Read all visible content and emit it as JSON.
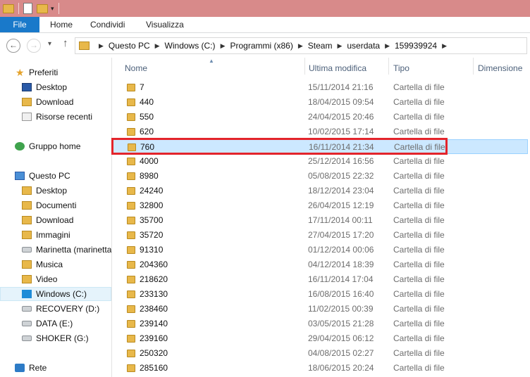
{
  "ribbon": {
    "tabs": [
      "File",
      "Home",
      "Condividi",
      "Visualizza"
    ]
  },
  "address": {
    "crumbs": [
      "Questo PC",
      "Windows (C:)",
      "Programmi (x86)",
      "Steam",
      "userdata",
      "159939924"
    ]
  },
  "nav": {
    "favorites_label": "Preferiti",
    "favorites": [
      "Desktop",
      "Download",
      "Risorse recenti"
    ],
    "homegroup_label": "Gruppo home",
    "thispc_label": "Questo PC",
    "thispc_items": [
      "Desktop",
      "Documenti",
      "Download",
      "Immagini",
      "Marinetta (marinetta",
      "Musica",
      "Video",
      "Windows (C:)",
      "RECOVERY (D:)",
      "DATA (E:)",
      "SHOKER (G:)"
    ],
    "network_label": "Rete",
    "selected": "Windows (C:)"
  },
  "columns": {
    "name": "Nome",
    "modified": "Ultima modifica",
    "type": "Tipo",
    "size": "Dimensione"
  },
  "files": [
    {
      "name": "7",
      "modified": "15/11/2014 21:16",
      "type": "Cartella di file"
    },
    {
      "name": "440",
      "modified": "18/04/2015 09:54",
      "type": "Cartella di file"
    },
    {
      "name": "550",
      "modified": "24/04/2015 20:46",
      "type": "Cartella di file"
    },
    {
      "name": "620",
      "modified": "10/02/2015 17:14",
      "type": "Cartella di file"
    },
    {
      "name": "760",
      "modified": "16/11/2014 21:34",
      "type": "Cartella di file"
    },
    {
      "name": "4000",
      "modified": "25/12/2014 16:56",
      "type": "Cartella di file"
    },
    {
      "name": "8980",
      "modified": "05/08/2015 22:32",
      "type": "Cartella di file"
    },
    {
      "name": "24240",
      "modified": "18/12/2014 23:04",
      "type": "Cartella di file"
    },
    {
      "name": "32800",
      "modified": "26/04/2015 12:19",
      "type": "Cartella di file"
    },
    {
      "name": "35700",
      "modified": "17/11/2014 00:11",
      "type": "Cartella di file"
    },
    {
      "name": "35720",
      "modified": "27/04/2015 17:20",
      "type": "Cartella di file"
    },
    {
      "name": "91310",
      "modified": "01/12/2014 00:06",
      "type": "Cartella di file"
    },
    {
      "name": "204360",
      "modified": "04/12/2014 18:39",
      "type": "Cartella di file"
    },
    {
      "name": "218620",
      "modified": "16/11/2014 17:04",
      "type": "Cartella di file"
    },
    {
      "name": "233130",
      "modified": "16/08/2015 16:40",
      "type": "Cartella di file"
    },
    {
      "name": "238460",
      "modified": "11/02/2015 00:39",
      "type": "Cartella di file"
    },
    {
      "name": "239140",
      "modified": "03/05/2015 21:28",
      "type": "Cartella di file"
    },
    {
      "name": "239160",
      "modified": "29/04/2015 06:12",
      "type": "Cartella di file"
    },
    {
      "name": "250320",
      "modified": "04/08/2015 02:27",
      "type": "Cartella di file"
    },
    {
      "name": "285160",
      "modified": "18/06/2015 20:24",
      "type": "Cartella di file"
    }
  ],
  "selected_file": "760",
  "colors": {
    "accent": "#1979ca",
    "titlebar": "#d88a8a",
    "highlight": "#e3242b",
    "selection": "#cce8ff"
  }
}
